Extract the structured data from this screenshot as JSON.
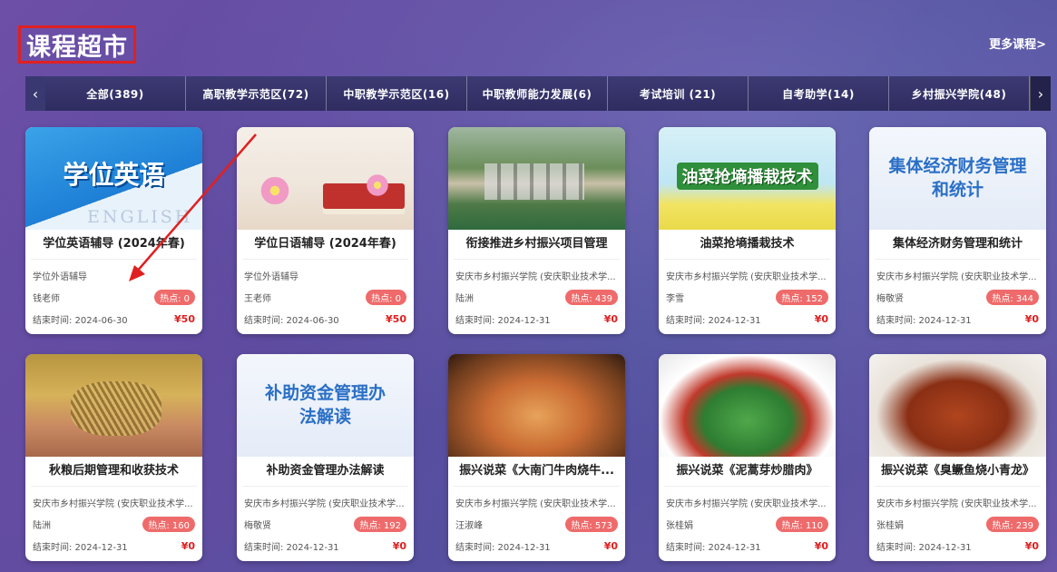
{
  "header": {
    "title": "课程超市",
    "more": "更多课程>"
  },
  "tabs": [
    "全部(389)",
    "高职教学示范区(72)",
    "中职教学示范区(16)",
    "中职教师能力发展(6)",
    "考试培训 (21)",
    "自考助学(14)",
    "乡村振兴学院(48)"
  ],
  "nav": {
    "prev": "‹",
    "next": "›"
  },
  "colors": {
    "accent": "#e02020",
    "badge": "#ef6b6b"
  },
  "cards": [
    {
      "title": "学位英语辅导 (2024年春)",
      "org": "学位外语辅导",
      "teacher": "钱老师",
      "hot": "热点: 0",
      "end": "结束时间: 2024-06-30",
      "price": "¥50",
      "thumb": "学位英语",
      "thumb2": "ENGLISH"
    },
    {
      "title": "学位日语辅导 (2024年春)",
      "org": "学位外语辅导",
      "teacher": "王老师",
      "hot": "热点: 0",
      "end": "结束时间: 2024-06-30",
      "price": "¥50",
      "thumb": "",
      "thumb2": ""
    },
    {
      "title": "衔接推进乡村振兴项目管理",
      "org": "安庆市乡村振兴学院 (安庆职业技术学...",
      "teacher": "陆洲",
      "hot": "热点: 439",
      "end": "结束时间: 2024-12-31",
      "price": "¥0",
      "thumb": "",
      "thumb2": ""
    },
    {
      "title": "油菜抢墒播栽技术",
      "org": "安庆市乡村振兴学院 (安庆职业技术学...",
      "teacher": "李雪",
      "hot": "热点: 152",
      "end": "结束时间: 2024-12-31",
      "price": "¥0",
      "thumb": "油菜抢墒播栽技术",
      "thumb2": ""
    },
    {
      "title": "集体经济财务管理和统计",
      "org": "安庆市乡村振兴学院 (安庆职业技术学...",
      "teacher": "梅敬贤",
      "hot": "热点: 344",
      "end": "结束时间: 2024-12-31",
      "price": "¥0",
      "thumb": "集体经济财务管理和统计",
      "thumb2": ""
    },
    {
      "title": "秋粮后期管理和收获技术",
      "org": "安庆市乡村振兴学院 (安庆职业技术学...",
      "teacher": "陆洲",
      "hot": "热点: 160",
      "end": "结束时间: 2024-12-31",
      "price": "¥0",
      "thumb": "",
      "thumb2": ""
    },
    {
      "title": "补助资金管理办法解读",
      "org": "安庆市乡村振兴学院 (安庆职业技术学...",
      "teacher": "梅敬贤",
      "hot": "热点: 192",
      "end": "结束时间: 2024-12-31",
      "price": "¥0",
      "thumb": "补助资金管理办法解读",
      "thumb2": ""
    },
    {
      "title": "振兴说菜《大南门牛肉烧牛...",
      "org": "安庆市乡村振兴学院 (安庆职业技术学...",
      "teacher": "汪淑峰",
      "hot": "热点: 573",
      "end": "结束时间: 2024-12-31",
      "price": "¥0",
      "thumb": "",
      "thumb2": ""
    },
    {
      "title": "振兴说菜《泥蒿芽炒腊肉》",
      "org": "安庆市乡村振兴学院 (安庆职业技术学...",
      "teacher": "张桂娟",
      "hot": "热点: 110",
      "end": "结束时间: 2024-12-31",
      "price": "¥0",
      "thumb": "",
      "thumb2": ""
    },
    {
      "title": "振兴说菜《臭鳜鱼烧小青龙》",
      "org": "安庆市乡村振兴学院 (安庆职业技术学...",
      "teacher": "张桂娟",
      "hot": "热点: 239",
      "end": "结束时间: 2024-12-31",
      "price": "¥0",
      "thumb": "",
      "thumb2": ""
    }
  ]
}
